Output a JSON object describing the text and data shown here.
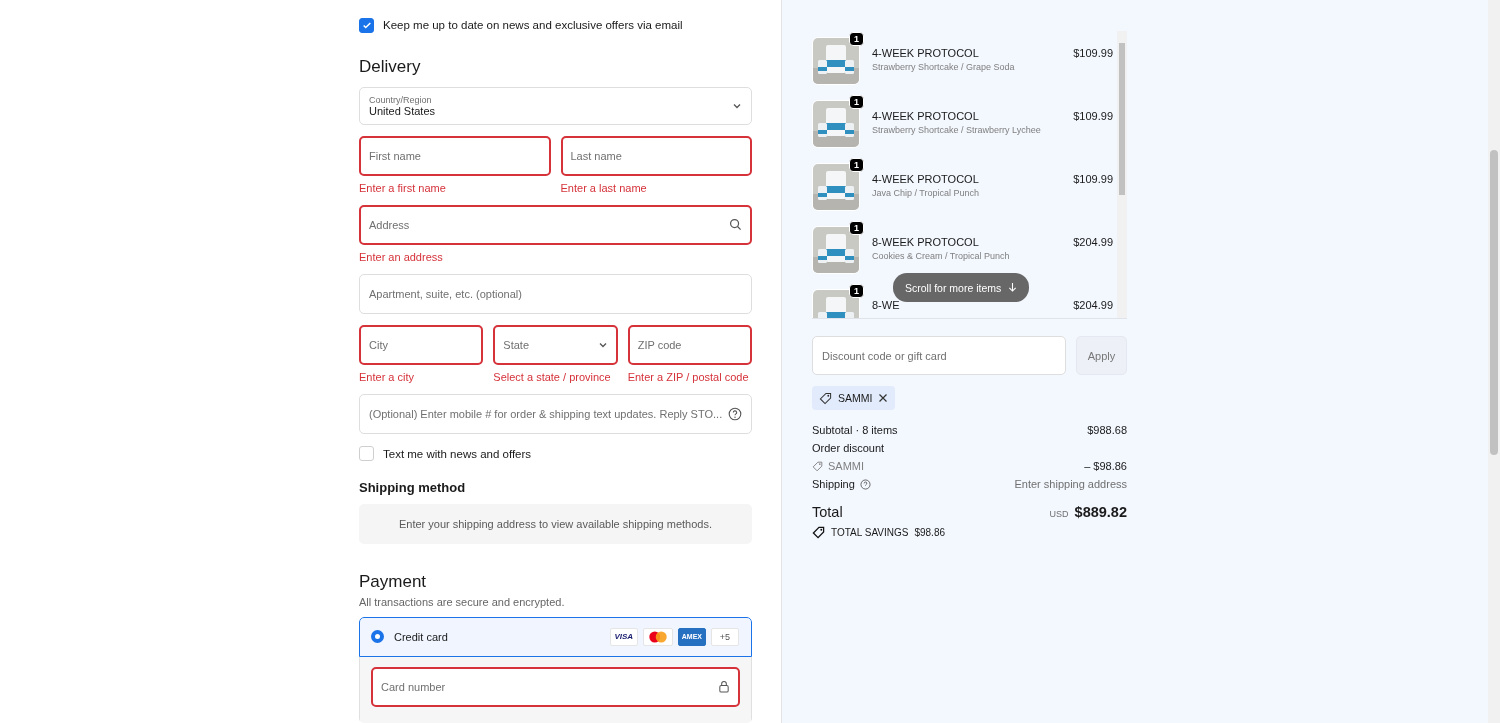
{
  "marketing_opt_in": {
    "label": "Keep me up to date on news and exclusive offers via email",
    "checked": true
  },
  "delivery": {
    "title": "Delivery",
    "country": {
      "label": "Country/Region",
      "value": "United States"
    },
    "rows": [
      [
        {
          "kind": "text",
          "placeholder": "First name",
          "invalid": true,
          "error": "Enter a first name"
        },
        {
          "kind": "text",
          "placeholder": "Last name",
          "invalid": true,
          "error": "Enter a last name"
        }
      ],
      [
        {
          "kind": "search",
          "placeholder": "Address",
          "invalid": true,
          "error": "Enter an address"
        }
      ],
      [
        {
          "kind": "text",
          "placeholder": "Apartment, suite, etc. (optional)",
          "invalid": false
        }
      ],
      [
        {
          "kind": "text",
          "placeholder": "City",
          "invalid": true,
          "error": "Enter a city"
        },
        {
          "kind": "select",
          "placeholder": "State",
          "invalid": true,
          "error": "Select a state / province"
        },
        {
          "kind": "text",
          "placeholder": "ZIP code",
          "invalid": true,
          "error": "Enter a ZIP / postal code"
        }
      ],
      [
        {
          "kind": "help",
          "placeholder": "(Optional) Enter mobile # for order & shipping text updates. Reply STO...",
          "invalid": false
        }
      ]
    ],
    "sms_opt_in": {
      "label": "Text me with news and offers",
      "checked": false
    }
  },
  "shipping_method": {
    "title": "Shipping method",
    "message": "Enter your shipping address to view available shipping methods."
  },
  "payment": {
    "title": "Payment",
    "subtitle": "All transactions are secure and encrypted.",
    "method": {
      "label": "Credit card",
      "selected": true,
      "cards": [
        {
          "kind": "visa",
          "text": "VISA"
        },
        {
          "kind": "mastercard"
        },
        {
          "kind": "amex",
          "text": "AMEX"
        },
        {
          "kind": "more",
          "text": "+5"
        }
      ]
    },
    "card_number": {
      "placeholder": "Card number",
      "invalid": true
    }
  },
  "order": {
    "items": [
      {
        "quantity": "1",
        "name": "4-WEEK PROTOCOL",
        "variant": "Strawberry Shortcake / Grape Soda",
        "price": "$109.99"
      },
      {
        "quantity": "1",
        "name": "4-WEEK PROTOCOL",
        "variant": "Strawberry Shortcake / Strawberry Lychee",
        "price": "$109.99"
      },
      {
        "quantity": "1",
        "name": "4-WEEK PROTOCOL",
        "variant": "Java Chip / Tropical Punch",
        "price": "$109.99"
      },
      {
        "quantity": "1",
        "name": "8-WEEK PROTOCOL",
        "variant": "Cookies & Cream / Tropical Punch",
        "price": "$204.99"
      },
      {
        "quantity": "1",
        "name": "8-WE",
        "price": "$204.99"
      }
    ],
    "scroll_hint": "Scroll for more items",
    "discount": {
      "placeholder": "Discount code or gift card",
      "button": "Apply"
    },
    "applied_code": "SAMMI",
    "subtotal": {
      "label": "Subtotal · 8 items",
      "value": "$988.68"
    },
    "order_discount": {
      "label": "Order discount",
      "code": "SAMMI",
      "value": "– $98.86"
    },
    "shipping": {
      "label": "Shipping",
      "value": "Enter shipping address"
    },
    "total": {
      "label": "Total",
      "currency": "USD",
      "value": "$889.82"
    },
    "savings": {
      "label": "TOTAL SAVINGS",
      "value": "$98.86"
    }
  }
}
